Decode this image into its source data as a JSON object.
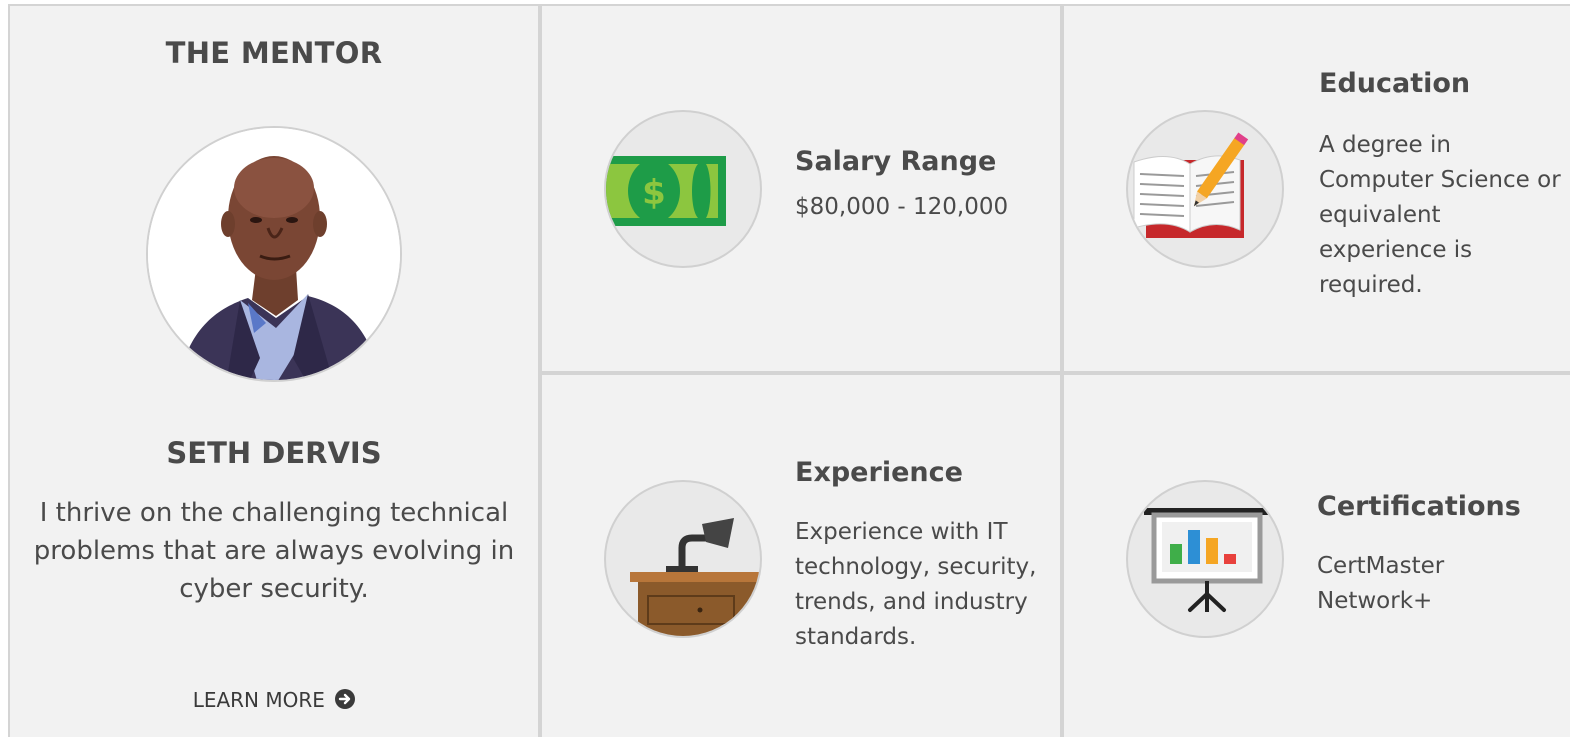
{
  "mentor": {
    "heading": "THE MENTOR",
    "name": "SETH DERVIS",
    "quote": "I thrive on the challenging technical problems that are always evolving in cyber security.",
    "learn_more": "LEARN MORE"
  },
  "salary": {
    "title": "Salary Range",
    "text": "$80,000 - 120,000",
    "icon": "money-bill-icon"
  },
  "education": {
    "title": "Education",
    "text": "A degree in Computer Science or equivalent experience is required.",
    "icon": "book-pencil-icon"
  },
  "experience": {
    "title": "Experience",
    "text": "Experience with IT technology, security, trends, and industry standards.",
    "icon": "desk-lamp-icon"
  },
  "certifications": {
    "title": "Certifications",
    "text": "CertMaster Network+",
    "icon": "presentation-board-icon"
  },
  "colors": {
    "panel_bg": "#f2f2f2",
    "panel_border": "#d4d4d4",
    "text": "#4a4a4a",
    "money_green": "#1e9c48",
    "money_light": "#8cc63f"
  }
}
